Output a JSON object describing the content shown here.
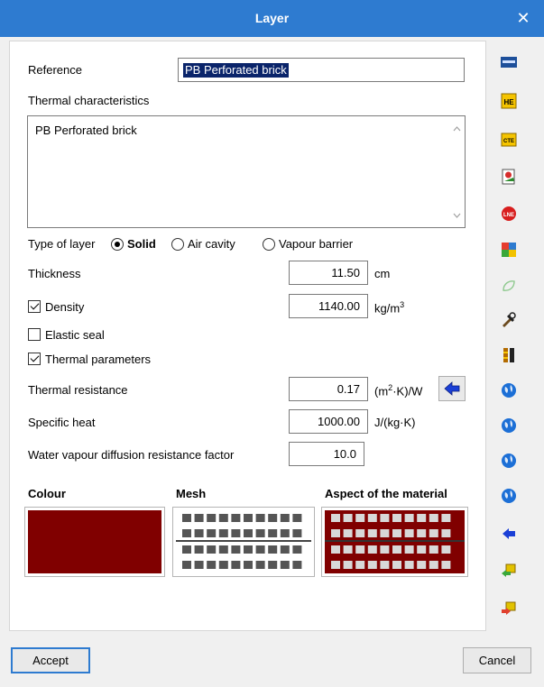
{
  "window": {
    "title": "Layer",
    "close_glyph": "✕"
  },
  "form": {
    "reference_label": "Reference",
    "reference_value": "PB Perforated brick",
    "thermal_label": "Thermal characteristics",
    "thermal_value": "PB Perforated brick",
    "type_label": "Type of layer",
    "type_options": [
      "Solid",
      "Air cavity",
      "Vapour barrier"
    ],
    "type_selected": "Solid",
    "thickness_label": "Thickness",
    "thickness_value": "11.50",
    "thickness_unit": "cm",
    "density_label": "Density",
    "density_checked": true,
    "density_value": "1140.00",
    "density_unit": "kg/m",
    "density_unit_sup": "3",
    "elastic_label": "Elastic seal",
    "elastic_checked": false,
    "thermal_params_label": "Thermal parameters",
    "thermal_params_checked": true,
    "resistance_label": "Thermal resistance",
    "resistance_value": "0.17",
    "resistance_unit_a": "(m",
    "resistance_unit_sup": "2",
    "resistance_unit_b": "·K)/W",
    "specific_heat_label": "Specific heat",
    "specific_heat_value": "1000.00",
    "specific_heat_unit": "J/(kg·K)",
    "vapour_label": "Water vapour diffusion resistance factor",
    "vapour_value": "10.0"
  },
  "appearance": {
    "colour_label": "Colour",
    "mesh_label": "Mesh",
    "aspect_label": "Aspect of the material",
    "colour_hex": "#800000"
  },
  "buttons": {
    "accept": "Accept",
    "cancel": "Cancel"
  },
  "sidebar_icons": [
    "material-database-icon",
    "cte-he-icon",
    "cte-icon",
    "catalogue-icon",
    "lned-icon",
    "colour-map-icon",
    "leaf-icon",
    "tools-icon",
    "layers-icon",
    "globe-icon",
    "globe-icon",
    "globe-icon",
    "globe-icon",
    "arrow-left-icon",
    "import-icon",
    "export-icon"
  ],
  "colors": {
    "titlebar": "#2e7bd0",
    "accent": "#0a246a",
    "brick": "#800000"
  }
}
